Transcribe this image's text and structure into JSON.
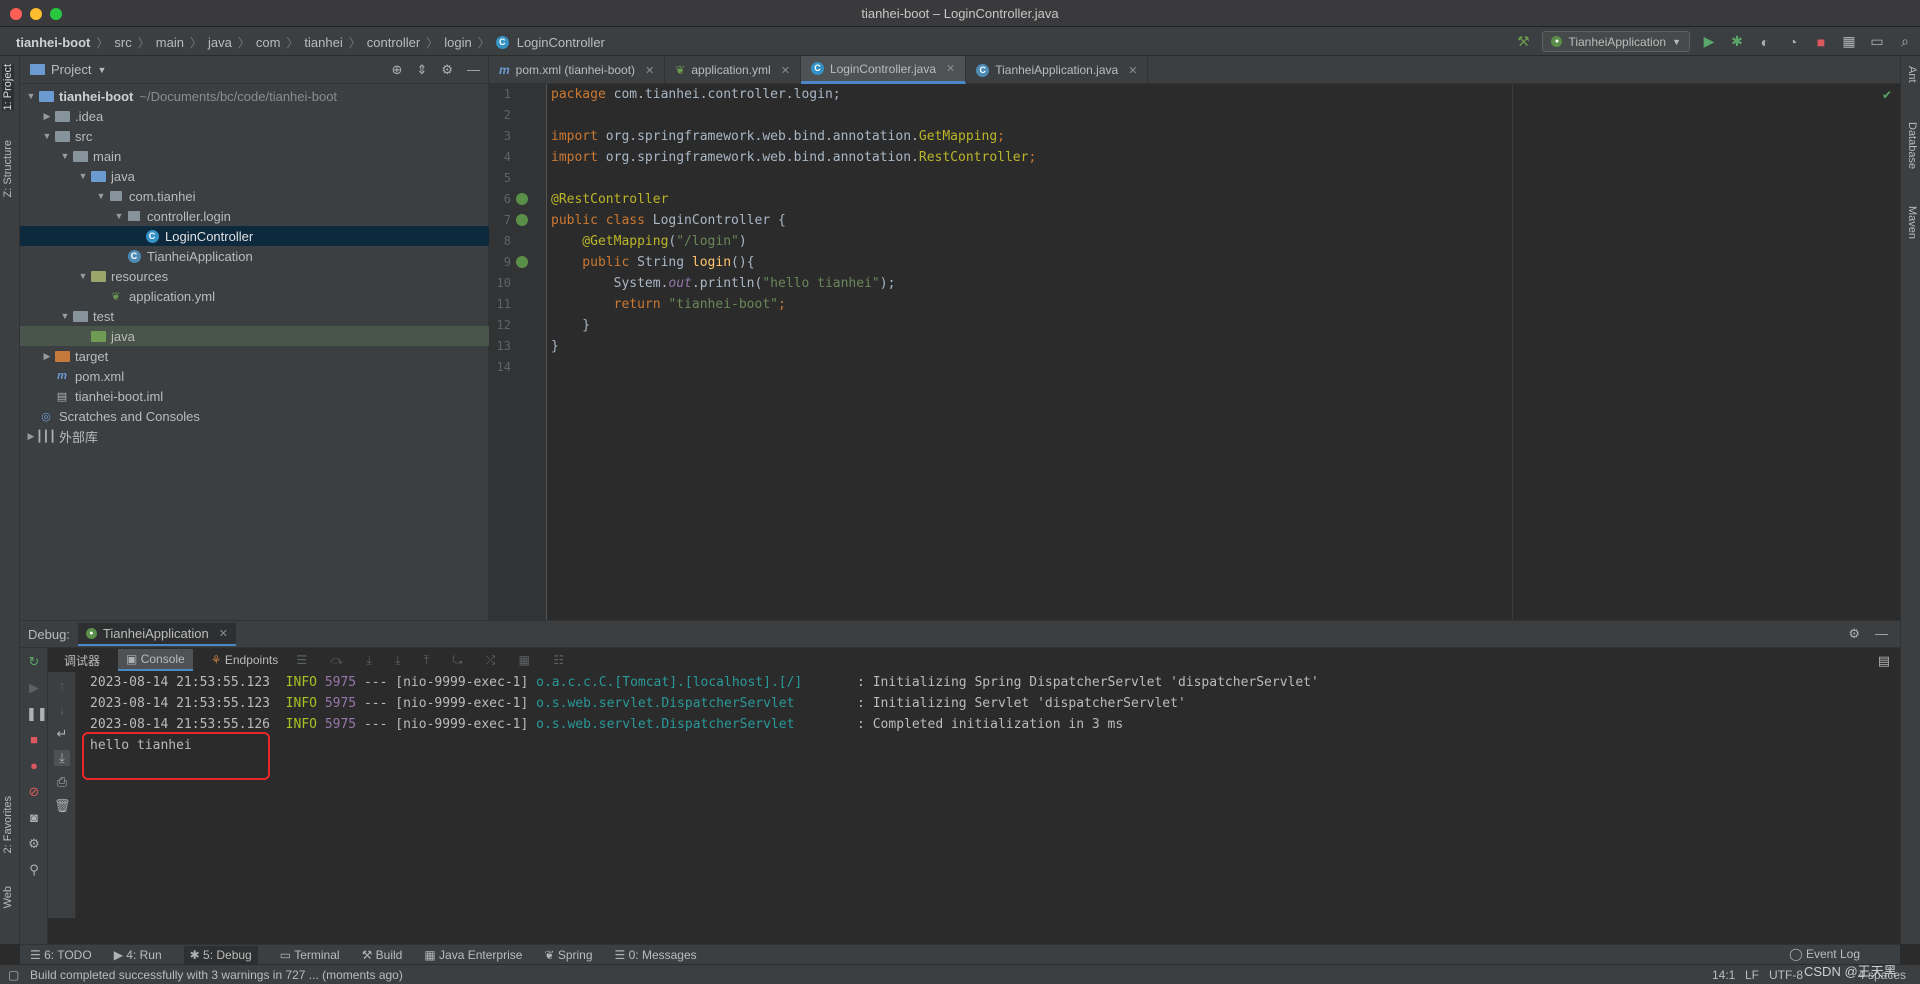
{
  "window": {
    "title": "tianhei-boot – LoginController.java",
    "traffic_colors": [
      "#ff5f57",
      "#febc2e",
      "#28c840"
    ]
  },
  "breadcrumb": [
    "tianhei-boot",
    "src",
    "main",
    "java",
    "com",
    "tianhei",
    "controller",
    "login",
    "LoginController"
  ],
  "run_config": "TianheiApplication",
  "project": {
    "header": "Project",
    "tree": [
      {
        "label": "tianhei-boot",
        "hint": "~/Documents/bc/code/tianhei-boot",
        "depth": 0,
        "arrow": "open",
        "icon": "folder-icon"
      },
      {
        "label": ".idea",
        "depth": 1,
        "arrow": "closed",
        "icon": "folder-icon"
      },
      {
        "label": "src",
        "depth": 1,
        "arrow": "open",
        "icon": "folder-icon"
      },
      {
        "label": "main",
        "depth": 2,
        "arrow": "open",
        "icon": "folder-icon"
      },
      {
        "label": "java",
        "depth": 3,
        "arrow": "open",
        "icon": "source-folder-icon"
      },
      {
        "label": "com.tianhei",
        "depth": 4,
        "arrow": "open",
        "icon": "package-icon"
      },
      {
        "label": "controller.login",
        "depth": 5,
        "arrow": "open",
        "icon": "package-icon"
      },
      {
        "label": "LoginController",
        "depth": 6,
        "arrow": "none",
        "icon": "class-icon",
        "selected": true
      },
      {
        "label": "TianheiApplication",
        "depth": 5,
        "arrow": "none",
        "icon": "spring-class-icon"
      },
      {
        "label": "resources",
        "depth": 3,
        "arrow": "open",
        "icon": "resources-folder-icon"
      },
      {
        "label": "application.yml",
        "depth": 4,
        "arrow": "none",
        "icon": "yaml-file-icon"
      },
      {
        "label": "test",
        "depth": 2,
        "arrow": "open",
        "icon": "folder-icon"
      },
      {
        "label": "java",
        "depth": 3,
        "arrow": "none",
        "icon": "test-folder-icon",
        "highlight": true
      },
      {
        "label": "target",
        "depth": 1,
        "arrow": "closed",
        "icon": "excluded-folder-icon"
      },
      {
        "label": "pom.xml",
        "depth": 1,
        "arrow": "none",
        "icon": "maven-file-icon"
      },
      {
        "label": "tianhei-boot.iml",
        "depth": 1,
        "arrow": "none",
        "icon": "iml-file-icon"
      },
      {
        "label": "Scratches and Consoles",
        "depth": 0,
        "arrow": "none",
        "icon": "scratches-icon"
      },
      {
        "label": "外部库",
        "depth": 0,
        "arrow": "closed",
        "icon": "library-icon"
      }
    ]
  },
  "editor": {
    "tabs": [
      {
        "label": "pom.xml (tianhei-boot)",
        "icon": "maven-file-icon",
        "active": false
      },
      {
        "label": "application.yml",
        "icon": "yaml-file-icon",
        "active": false
      },
      {
        "label": "LoginController.java",
        "icon": "class-icon",
        "active": true
      },
      {
        "label": "TianheiApplication.java",
        "icon": "spring-class-icon",
        "active": false
      }
    ],
    "line_numbers": [
      "1",
      "2",
      "3",
      "4",
      "5",
      "6",
      "7",
      "8",
      "9",
      "10",
      "11",
      "12",
      "13",
      "14"
    ],
    "code": {
      "l1_kw": "package",
      "l1_rest": " com.tianhei.controller.login;",
      "l3_kw": "import",
      "l3_rest": " org.springframework.web.bind.annotation.",
      "l3_ann": "GetMapping",
      "l3_end": ";",
      "l4_kw": "import",
      "l4_rest": " org.springframework.web.bind.annotation.",
      "l4_ann": "RestController",
      "l4_end": ";",
      "l6_ann": "@RestController",
      "l7_kw": "public class",
      "l7_rest": " LoginController {",
      "l8_ann": "    @GetMapping",
      "l8_p1": "(",
      "l8_str": "\"/login\"",
      "l8_p2": ")",
      "l9_kw": "    public",
      "l9_rest": " String ",
      "l9_name": "login",
      "l9_end": "(){",
      "l10_a": "        System.",
      "l10_fld": "out",
      "l10_b": ".println(",
      "l10_str": "\"hello tianhei\"",
      "l10_c": ");",
      "l11_kw": "        return",
      "l11_str": " \"tianhei-boot\"",
      "l11_end": ";",
      "l12": "    }",
      "l13": "}"
    }
  },
  "debug": {
    "label": "Debug:",
    "session": "TianheiApplication",
    "subtabs": [
      "调试器",
      "Console",
      "Endpoints"
    ],
    "log": [
      {
        "ts": "2023-08-14 21:53:55.123",
        "level": "INFO",
        "pid": "5975",
        "thread": "--- [nio-9999-exec-1]",
        "logger": "o.a.c.c.C.[Tomcat].[localhost].[/]      ",
        "msg": " : Initializing Spring DispatcherServlet 'dispatcherServlet'"
      },
      {
        "ts": "2023-08-14 21:53:55.123",
        "level": "INFO",
        "pid": "5975",
        "thread": "--- [nio-9999-exec-1]",
        "logger": "o.s.web.servlet.DispatcherServlet       ",
        "msg": " : Initializing Servlet 'dispatcherServlet'"
      },
      {
        "ts": "2023-08-14 21:53:55.126",
        "level": "INFO",
        "pid": "5975",
        "thread": "--- [nio-9999-exec-1]",
        "logger": "o.s.web.servlet.DispatcherServlet       ",
        "msg": " : Completed initialization in 3 ms"
      }
    ],
    "output": "hello tianhei"
  },
  "bottom_tools": [
    "6: TODO",
    "4: Run",
    "5: Debug",
    "Terminal",
    "Build",
    "Java Enterprise",
    "Spring",
    "0: Messages"
  ],
  "event_log": "Event Log",
  "left_stripe": [
    "1: Project",
    "Z: Structure",
    "2: Favorites",
    "Web"
  ],
  "right_stripe": [
    "Ant",
    "Database",
    "Maven"
  ],
  "status": {
    "message": "Build completed successfully with 3 warnings in 727 ... (moments ago)",
    "position": "14:1",
    "line_sep": "LF",
    "encoding": "UTF-8",
    "indent": "4 spaces",
    "watermark": "CSDN @王天黑"
  }
}
